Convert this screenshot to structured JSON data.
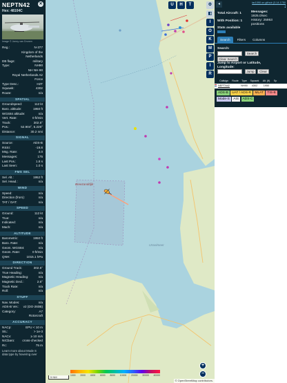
{
  "aircraft": {
    "callsign": "NEPTN42",
    "hex_label": "Hex: 48104C",
    "photo_credit": "Image © Jonny van Drunen"
  },
  "details": [
    {
      "k": "Reg.:",
      "v": "N-377"
    },
    {
      "k": "",
      "v": "Kingdom of the"
    },
    {
      "k": "",
      "v": "Netherlands"
    },
    {
      "k": "DB flags:",
      "v": "military"
    },
    {
      "k": "Type:",
      "v": "NH90"
    },
    {
      "k": "",
      "v": "NH NH-90"
    },
    {
      "k": "",
      "v": "Royal Netherlands Air"
    },
    {
      "k": "",
      "v": "Force"
    },
    {
      "k": "Type Desc.:",
      "v": "H2T"
    },
    {
      "k": "Squawk:",
      "v": "4302"
    },
    {
      "k": "Route:",
      "v": "n/a"
    }
  ],
  "sections": {
    "spatial": "SPATIAL",
    "signal": "SIGNAL",
    "fms": "FMS SEL",
    "wind": "WIND",
    "speed": "SPEED",
    "altitude": "ALTITUDE",
    "direction": "DIRECTION",
    "stuff": "STUFF",
    "accuracy": "ACCURACY"
  },
  "spatial": [
    {
      "k": "Groundspeed:",
      "v": "112 kt"
    },
    {
      "k": "Baro. altitude:",
      "v": "1950 ft"
    },
    {
      "k": "WGS84 altitude:",
      "v": "n/a"
    },
    {
      "k": "Vert. Rate:",
      "v": "0 ft/min"
    },
    {
      "k": "Track:",
      "v": "302.5°"
    },
    {
      "k": "Pos.:",
      "v": "52.904°, 5.226°"
    },
    {
      "k": "Distance:",
      "v": "30.2 nmi"
    }
  ],
  "signal": [
    {
      "k": "Source:",
      "v": "ADS-B"
    },
    {
      "k": "RSSI:",
      "v": "-19.8"
    },
    {
      "k": "Msg. Rate:",
      "v": "4.0"
    },
    {
      "k": "Messages:",
      "v": "175"
    },
    {
      "k": "Last Pos.:",
      "v": "1.8 s"
    },
    {
      "k": "Last Seen:",
      "v": "1.0 s"
    }
  ],
  "fms": [
    {
      "k": "Sel. Alt.:",
      "v": "1952 ft"
    },
    {
      "k": "Sel. Head.:",
      "v": "n/a"
    }
  ],
  "wind": [
    {
      "k": "Speed:",
      "v": "n/a"
    },
    {
      "k": "Direction (from):",
      "v": "n/a"
    },
    {
      "k": "TAT / OAT:",
      "v": "n/a"
    }
  ],
  "speed": [
    {
      "k": "Ground:",
      "v": "112 kt"
    },
    {
      "k": "True:",
      "v": "n/a"
    },
    {
      "k": "Indicated:",
      "v": "n/a"
    },
    {
      "k": "Mach:",
      "v": "n/a"
    }
  ],
  "altitude": [
    {
      "k": "Barometric:",
      "v": "1950 ft"
    },
    {
      "k": "Baro. Rate:",
      "v": "n/a"
    },
    {
      "k": "Geom. WGS84:",
      "v": "n/a"
    },
    {
      "k": "Geom. Rate:",
      "v": "0 ft/min"
    },
    {
      "k": "QNH:",
      "v": "1015.1 hPa"
    }
  ],
  "direction": [
    {
      "k": "Ground Track:",
      "v": "302.5°"
    },
    {
      "k": "True Heading:",
      "v": "n/a"
    },
    {
      "k": "Magnetic Heading:",
      "v": "n/a"
    },
    {
      "k": "Magnetic Decl.:",
      "v": "2.6°"
    },
    {
      "k": "Track Rate:",
      "v": "n/a"
    },
    {
      "k": "Roll:",
      "v": "n/a"
    }
  ],
  "stuff": [
    {
      "k": "Nav. Modes:",
      "v": "n/a"
    },
    {
      "k": "ADS-B Ver.:",
      "v": "v2 (DO-260B)"
    },
    {
      "k": "Category:",
      "v": "A7"
    },
    {
      "k": "",
      "v": "Rotorcraft"
    }
  ],
  "accuracy": [
    {
      "k": "NACp:",
      "v": "EPU < 10 m"
    },
    {
      "k": "SIL:",
      "v": "> 1e-3"
    },
    {
      "k": "NACv:",
      "v": "≥ 10 m/s"
    },
    {
      "k": "NICbaro:",
      "v": "cross-checked"
    },
    {
      "k": "Rc:",
      "v": "75 m"
    }
  ],
  "footer": {
    "line1": "Learn more about Mode S",
    "line2": "data type by hovering over"
  },
  "map": {
    "buttons": [
      "U",
      "H",
      "T"
    ],
    "side_buttons": [
      "I",
      "O",
      "K",
      "M",
      "P",
      "I",
      "R"
    ],
    "place_label_1": "Breezanddijk",
    "place_label_2": "IJsselmeer",
    "scale": "5 NM",
    "attribution": "© OpenStreetMap contributors.",
    "alt_labels": [
      "1000",
      "2000",
      "4000",
      "6000",
      "8000",
      "10000",
      "20000",
      "30000",
      "40000"
    ],
    "zoom_in": "+",
    "zoom_out": "−"
  },
  "right": {
    "link_line1": "tar1090 on github (3.14.1750",
    "link_line2": ")",
    "total_aircraft": "Total Aircraft: 1",
    "with_position": "With Position: 1",
    "stats_available": "Stats available",
    "messages_label": "Messages:",
    "messages_value": "1925.0/sec",
    "history_label": "History: 25953",
    "history_positions": "positions",
    "tabs": [
      "Search",
      "Filters",
      "Columns"
    ],
    "search_label": "Search:",
    "search_btn": "Search",
    "clear_search": "Clear Search",
    "jump_label": "Jump to Airport or Latitude, Longitude:",
    "jump_btn": "Jump",
    "clear_btn": "Clear",
    "columns": [
      "Callsign",
      "Route",
      "Type",
      "Squawk",
      "Alt. (ft)",
      "Sp"
    ],
    "rows": [
      {
        "callsign": "NEPTN42",
        "route": "",
        "type": "NH90",
        "squawk": "4302",
        "alt": "1950"
      }
    ],
    "legend": [
      {
        "label": "ADS-B",
        "color": "#8bd27a"
      },
      {
        "label": "UAT / ADS-R",
        "color": "#ffd24a"
      },
      {
        "label": "MLAT",
        "color": "#ffb050"
      },
      {
        "label": "TIS-B",
        "color": "#ff8c8c"
      },
      {
        "label": "Mode-S",
        "color": "#c9c9f0"
      },
      {
        "label": "AIS",
        "color": "#f2f2f2"
      },
      {
        "label": "ADS-C",
        "color": "#8bd27a"
      }
    ]
  },
  "colors": {
    "panel_bg": "#0f2630",
    "section_bg": "#1c4354",
    "water": "#aad3df",
    "land": "#dfe9c6",
    "track": "#ffa07a",
    "accent": "#2d7fb8"
  }
}
